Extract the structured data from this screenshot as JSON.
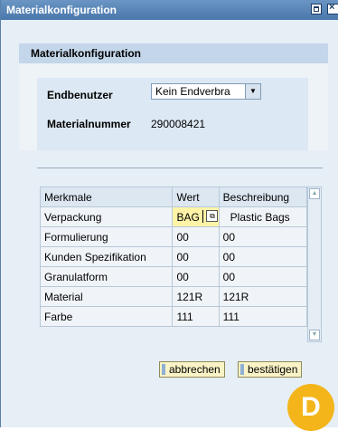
{
  "window": {
    "title": "Materialkonfiguration"
  },
  "panel": {
    "header": "Materialkonfiguration"
  },
  "form": {
    "endbenutzer_label": "Endbenutzer",
    "endbenutzer_value": "Kein Endverbra",
    "materialnummer_label": "Materialnummer",
    "materialnummer_value": "290008421"
  },
  "table": {
    "headers": [
      "Merkmale",
      "Wert",
      "Beschreibung"
    ],
    "rows": [
      {
        "merkmal": "Verpackung",
        "wert": "BAG",
        "beschreibung": "Plastic Bags"
      },
      {
        "merkmal": "Formulierung",
        "wert": "00",
        "beschreibung": "00"
      },
      {
        "merkmal": "Kunden Spezifikation",
        "wert": "00",
        "beschreibung": "00"
      },
      {
        "merkmal": "Granulatform",
        "wert": "00",
        "beschreibung": "00"
      },
      {
        "merkmal": "Material",
        "wert": "121R",
        "beschreibung": "121R"
      },
      {
        "merkmal": "Farbe",
        "wert": "111",
        "beschreibung": "111"
      }
    ]
  },
  "buttons": {
    "cancel": "abbrechen",
    "confirm": "bestätigen"
  },
  "badge": {
    "letter": "D"
  },
  "icons": {
    "maximize": "maximize-icon",
    "close": "close-icon",
    "dropdown": "chevron-down-icon",
    "value_help": "value-help-icon",
    "scroll_up": "scroll-up-icon",
    "scroll_down": "scroll-down-icon"
  },
  "colors": {
    "titlebar": "#4a78ab",
    "panel_header": "#c3d6ea",
    "active_input": "#fff3a8",
    "button": "#f9f3c6",
    "badge": "#f3b51a"
  }
}
